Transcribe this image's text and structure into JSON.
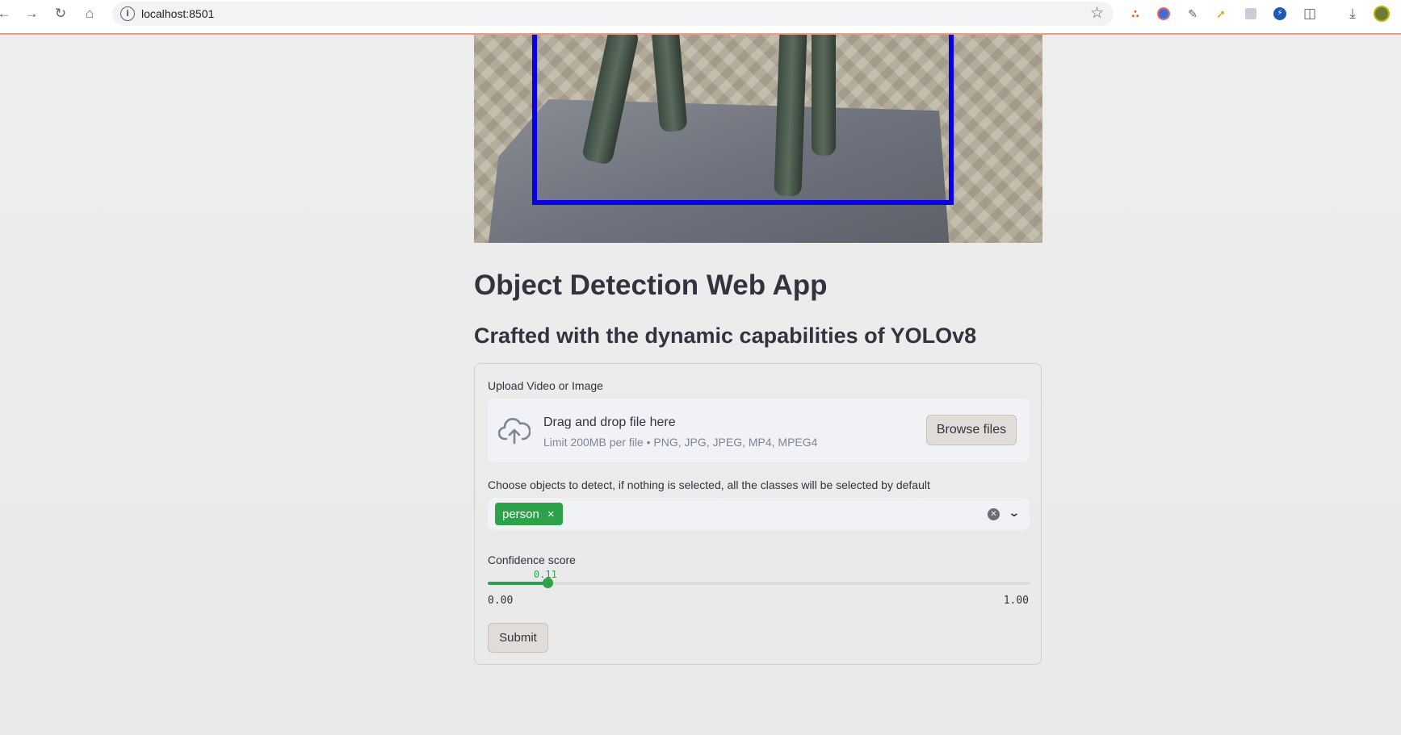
{
  "browser": {
    "url": "localhost:8501"
  },
  "app": {
    "title": "Object Detection Web App",
    "subtitle": "Crafted with the dynamic capabilities of YOLOv8"
  },
  "uploader": {
    "label": "Upload Video or Image",
    "drop_text": "Drag and drop file here",
    "limit_text": "Limit 200MB per file • PNG, JPG, JPEG, MP4, MPEG4",
    "browse_label": "Browse files"
  },
  "classes": {
    "label": "Choose objects to detect, if nothing is selected, all the classes will be selected by default",
    "selected": [
      {
        "label": "person",
        "remove": "×"
      }
    ]
  },
  "confidence": {
    "label": "Confidence score",
    "value": 0.11,
    "value_text": "0.11",
    "min": 0.0,
    "max": 1.0,
    "min_text": "0.00",
    "max_text": "1.00"
  },
  "submit_label": "Submit",
  "colors": {
    "accent": "#2ea24a",
    "bbox": "#0a00e6"
  }
}
